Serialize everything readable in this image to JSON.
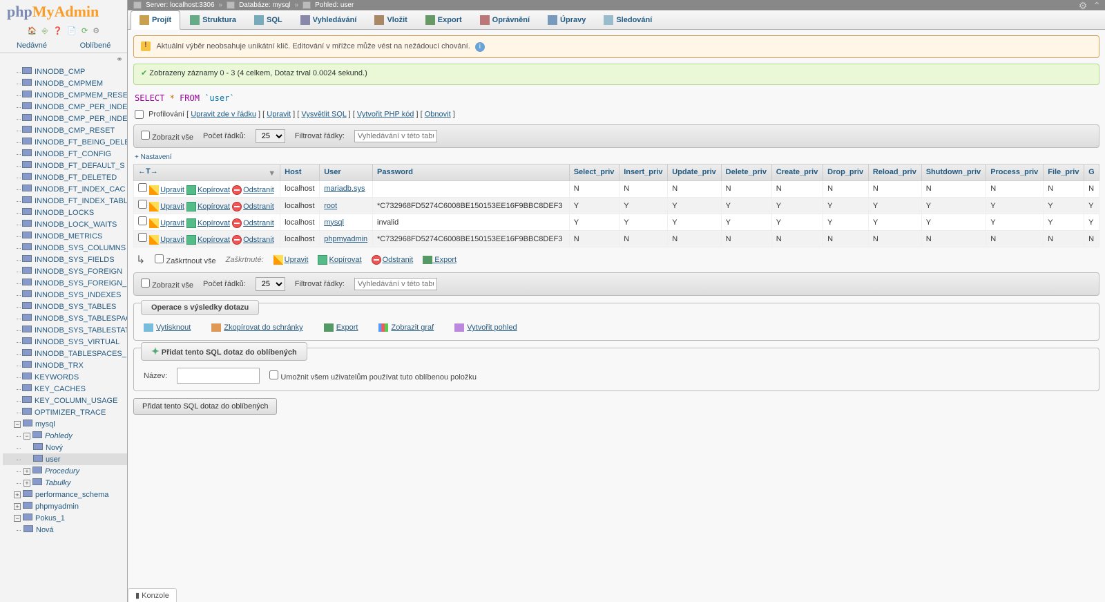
{
  "breadcrumb": {
    "server": "Server: localhost:3306",
    "database": "Databáze: mysql",
    "view": "Pohled: user"
  },
  "sidebar": {
    "recent": "Nedávné",
    "favorites": "Oblíbené",
    "is_tables": [
      "INNODB_CMP",
      "INNODB_CMPMEM",
      "INNODB_CMPMEM_RESET",
      "INNODB_CMP_PER_INDEX",
      "INNODB_CMP_PER_INDEX_R",
      "INNODB_CMP_RESET",
      "INNODB_FT_BEING_DELE",
      "INNODB_FT_CONFIG",
      "INNODB_FT_DEFAULT_S",
      "INNODB_FT_DELETED",
      "INNODB_FT_INDEX_CAC",
      "INNODB_FT_INDEX_TABL",
      "INNODB_LOCKS",
      "INNODB_LOCK_WAITS",
      "INNODB_METRICS",
      "INNODB_SYS_COLUMNS",
      "INNODB_SYS_FIELDS",
      "INNODB_SYS_FOREIGN",
      "INNODB_SYS_FOREIGN_",
      "INNODB_SYS_INDEXES",
      "INNODB_SYS_TABLES",
      "INNODB_SYS_TABLESPAC",
      "INNODB_SYS_TABLESTAT",
      "INNODB_SYS_VIRTUAL",
      "INNODB_TABLESPACES_",
      "INNODB_TRX",
      "KEYWORDS",
      "KEY_CACHES",
      "KEY_COLUMN_USAGE",
      "OPTIMIZER_TRACE"
    ],
    "mysql": "mysql",
    "views": "Pohledy",
    "new": "Nový",
    "user": "user",
    "procedures": "Procedury",
    "tables": "Tabulky",
    "perf": "performance_schema",
    "pma": "phpmyadmin",
    "pokus": "Pokus_1",
    "nova": "Nová"
  },
  "tabs": {
    "browse": "Projít",
    "structure": "Struktura",
    "sql": "SQL",
    "search": "Vyhledávání",
    "insert": "Vložit",
    "export": "Export",
    "privileges": "Oprávnění",
    "operations": "Úpravy",
    "tracking": "Sledování"
  },
  "notice": {
    "text": "Aktuální výběr neobsahuje unikátní klíč. Editování v mřížce může vést na nežádoucí chování."
  },
  "success": {
    "text": "Zobrazeny záznamy 0 - 3 (4 celkem, Dotaz trval 0.0024 sekund.)"
  },
  "sql": {
    "select": "SELECT",
    "star": "*",
    "from": "FROM",
    "table": "`user`"
  },
  "links": {
    "profiling": "Profilování",
    "inline": "Upravit zde v řádku",
    "edit": "Upravit",
    "explain": "Vysvětlit SQL",
    "php": "Vytvořit PHP kód",
    "refresh": "Obnovit"
  },
  "toolbar": {
    "showall": "Zobrazit vše",
    "rows": "Počet řádků:",
    "rowval": "25",
    "filter": "Filtrovat řádky:",
    "placeholder": "Vyhledávání v této tabulce"
  },
  "extra": "+ Nastavení",
  "columns": [
    "Host",
    "User",
    "Password",
    "Select_priv",
    "Insert_priv",
    "Update_priv",
    "Delete_priv",
    "Create_priv",
    "Drop_priv",
    "Reload_priv",
    "Shutdown_priv",
    "Process_priv",
    "File_priv",
    "G"
  ],
  "actions": {
    "edit": "Upravit",
    "copy": "Kopírovat",
    "delete": "Odstranit"
  },
  "rows": [
    {
      "host": "localhost",
      "user": "mariadb.sys",
      "pass": "",
      "privs": [
        "N",
        "N",
        "N",
        "N",
        "N",
        "N",
        "N",
        "N",
        "N",
        "N",
        "N"
      ]
    },
    {
      "host": "localhost",
      "user": "root",
      "pass": "*C732968FD5274C6008BE150153EE16F9BBC8DEF3",
      "privs": [
        "Y",
        "Y",
        "Y",
        "Y",
        "Y",
        "Y",
        "Y",
        "Y",
        "Y",
        "Y",
        "Y"
      ]
    },
    {
      "host": "localhost",
      "user": "mysql",
      "pass": "invalid",
      "privs": [
        "Y",
        "Y",
        "Y",
        "Y",
        "Y",
        "Y",
        "Y",
        "Y",
        "Y",
        "Y",
        "Y"
      ]
    },
    {
      "host": "localhost",
      "user": "phpmyadmin",
      "pass": "*C732968FD5274C6008BE150153EE16F9BBC8DEF3",
      "privs": [
        "N",
        "N",
        "N",
        "N",
        "N",
        "N",
        "N",
        "N",
        "N",
        "N",
        "N"
      ]
    }
  ],
  "bulk": {
    "checkall": "Zaškrtnout vše",
    "selected": "Zaškrtnuté:",
    "edit": "Upravit",
    "copy": "Kopírovat",
    "delete": "Odstranit",
    "export": "Export"
  },
  "resops": {
    "title": "Operace s výsledky dotazu",
    "print": "Vytisknout",
    "clip": "Zkopírovat do schránky",
    "export": "Export",
    "chart": "Zobrazit graf",
    "view": "Vytvořit pohled"
  },
  "bookmark": {
    "title": "Přidat tento SQL dotaz do oblíbených",
    "name": "Název:",
    "allusers": "Umožnit všem uživatelům používat tuto oblíbenou položku",
    "btn": "Přidat tento SQL dotaz do oblíbených"
  },
  "console": "Konzole"
}
